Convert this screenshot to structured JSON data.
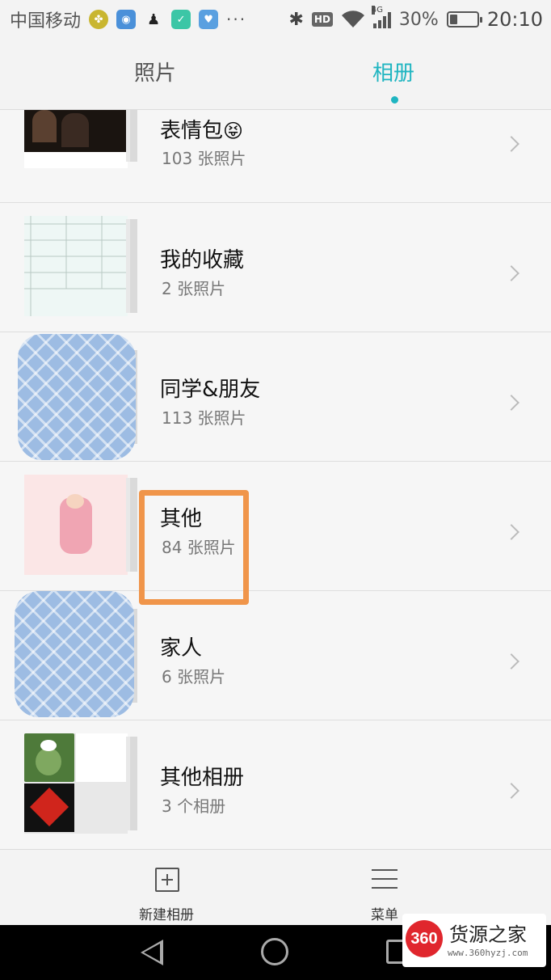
{
  "status_bar": {
    "carrier": "中国移动",
    "icons": [
      "pinwheel-icon",
      "wifi-hotspot-icon",
      "qq-penguin-icon",
      "shield-icon",
      "health-icon"
    ],
    "overflow": "···",
    "bluetooth": "✱",
    "hd": "HD",
    "network": "4G",
    "battery_percent": "30%",
    "battery_level": 0.3,
    "time": "20:10"
  },
  "tabs": {
    "photos": "照片",
    "albums": "相册",
    "active": "albums",
    "accent_color": "#1fb5c1"
  },
  "albums": [
    {
      "name": "表情包",
      "emoji": "😝",
      "count": "103 张照片"
    },
    {
      "name": "我的收藏",
      "count": "2 张照片"
    },
    {
      "name": "同学&朋友",
      "count": "113 张照片"
    },
    {
      "name": "其他",
      "count": "84 张照片"
    },
    {
      "name": "家人",
      "count": "6 张照片"
    },
    {
      "name": "其他相册",
      "count": "3 个相册"
    }
  ],
  "toolbar": {
    "new_album": "新建相册",
    "menu": "菜单"
  },
  "watermark": {
    "logo": "360",
    "title": "货源之家",
    "url": "www.360hyzj.com"
  }
}
